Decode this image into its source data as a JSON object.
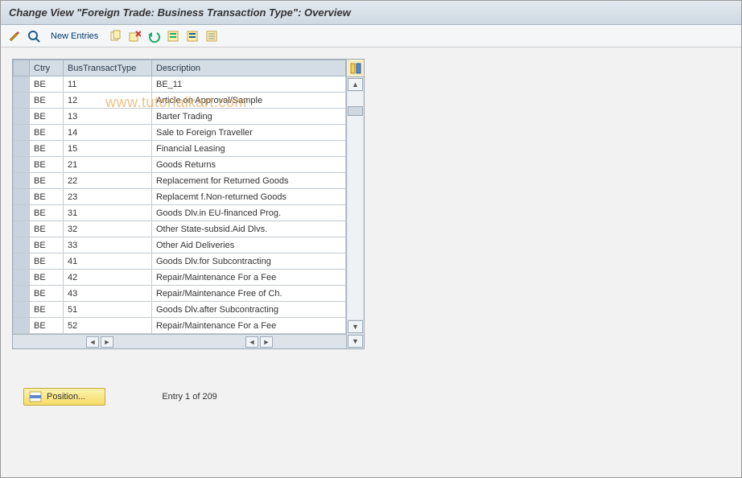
{
  "title": "Change View \"Foreign Trade: Business Transaction Type\": Overview",
  "toolbar": {
    "new_entries_label": "New Entries"
  },
  "watermark": "www.tutorialkart.com",
  "grid": {
    "headers": {
      "ctry": "Ctry",
      "btt": "BusTransactType",
      "desc": "Description"
    },
    "rows": [
      {
        "ctry": "BE",
        "btt": "11",
        "desc": "BE_11"
      },
      {
        "ctry": "BE",
        "btt": "12",
        "desc": "Article on Approval/Sample"
      },
      {
        "ctry": "BE",
        "btt": "13",
        "desc": "Barter Trading"
      },
      {
        "ctry": "BE",
        "btt": "14",
        "desc": "Sale to Foreign Traveller"
      },
      {
        "ctry": "BE",
        "btt": "15",
        "desc": "Financial Leasing"
      },
      {
        "ctry": "BE",
        "btt": "21",
        "desc": "Goods Returns"
      },
      {
        "ctry": "BE",
        "btt": "22",
        "desc": "Replacement for Returned Goods"
      },
      {
        "ctry": "BE",
        "btt": "23",
        "desc": "Replacemt f.Non-returned Goods"
      },
      {
        "ctry": "BE",
        "btt": "31",
        "desc": "Goods Dlv.in EU-financed Prog."
      },
      {
        "ctry": "BE",
        "btt": "32",
        "desc": "Other State-subsid.Aid Dlvs."
      },
      {
        "ctry": "BE",
        "btt": "33",
        "desc": "Other Aid Deliveries"
      },
      {
        "ctry": "BE",
        "btt": "41",
        "desc": "Goods Dlv.for Subcontracting"
      },
      {
        "ctry": "BE",
        "btt": "42",
        "desc": "Repair/Maintenance For a Fee"
      },
      {
        "ctry": "BE",
        "btt": "43",
        "desc": "Repair/Maintenance Free of Ch."
      },
      {
        "ctry": "BE",
        "btt": "51",
        "desc": "Goods Dlv.after Subcontracting"
      },
      {
        "ctry": "BE",
        "btt": "52",
        "desc": "Repair/Maintenance For a Fee"
      }
    ]
  },
  "footer": {
    "position_label": "Position...",
    "entry_text": "Entry 1 of 209"
  }
}
